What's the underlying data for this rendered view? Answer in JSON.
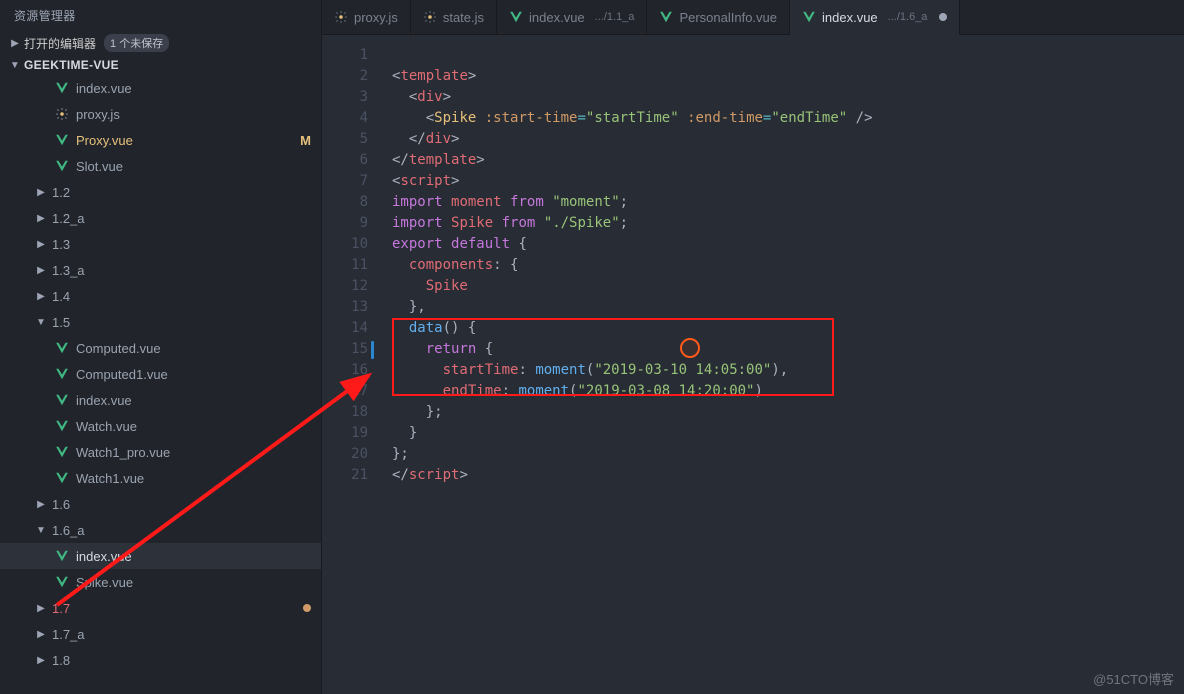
{
  "sidebar": {
    "title": "资源管理器",
    "open_editors_label": "打开的编辑器",
    "open_editors_badge": "1 个未保存",
    "project_name": "GEEKTIME-VUE",
    "items": [
      {
        "type": "file",
        "icon": "vue",
        "label": "index.vue",
        "indent": 3
      },
      {
        "type": "file",
        "icon": "js",
        "label": "proxy.js",
        "indent": 3
      },
      {
        "type": "file",
        "icon": "vue",
        "label": "Proxy.vue",
        "indent": 3,
        "modified": true,
        "status": "M"
      },
      {
        "type": "file",
        "icon": "vue",
        "label": "Slot.vue",
        "indent": 3
      },
      {
        "type": "folder",
        "label": "1.2",
        "indent": 2,
        "expanded": false
      },
      {
        "type": "folder",
        "label": "1.2_a",
        "indent": 2,
        "expanded": false
      },
      {
        "type": "folder",
        "label": "1.3",
        "indent": 2,
        "expanded": false
      },
      {
        "type": "folder",
        "label": "1.3_a",
        "indent": 2,
        "expanded": false
      },
      {
        "type": "folder",
        "label": "1.4",
        "indent": 2,
        "expanded": false
      },
      {
        "type": "folder",
        "label": "1.5",
        "indent": 2,
        "expanded": true
      },
      {
        "type": "file",
        "icon": "vue",
        "label": "Computed.vue",
        "indent": 3
      },
      {
        "type": "file",
        "icon": "vue",
        "label": "Computed1.vue",
        "indent": 3
      },
      {
        "type": "file",
        "icon": "vue",
        "label": "index.vue",
        "indent": 3
      },
      {
        "type": "file",
        "icon": "vue",
        "label": "Watch.vue",
        "indent": 3
      },
      {
        "type": "file",
        "icon": "vue",
        "label": "Watch1_pro.vue",
        "indent": 3
      },
      {
        "type": "file",
        "icon": "vue",
        "label": "Watch1.vue",
        "indent": 3
      },
      {
        "type": "folder",
        "label": "1.6",
        "indent": 2,
        "expanded": false
      },
      {
        "type": "folder",
        "label": "1.6_a",
        "indent": 2,
        "expanded": true
      },
      {
        "type": "file",
        "icon": "vue",
        "label": "index.vue",
        "indent": 3,
        "selected": true
      },
      {
        "type": "file",
        "icon": "vue",
        "label": "Spike.vue",
        "indent": 3
      },
      {
        "type": "folder",
        "label": "1.7",
        "indent": 2,
        "expanded": false,
        "git": true,
        "dot": true
      },
      {
        "type": "folder",
        "label": "1.7_a",
        "indent": 2,
        "expanded": false
      },
      {
        "type": "folder",
        "label": "1.8",
        "indent": 2,
        "expanded": false
      }
    ]
  },
  "tabs": [
    {
      "icon": "js",
      "label": "proxy.js"
    },
    {
      "icon": "js",
      "label": "state.js"
    },
    {
      "icon": "vue",
      "label": "index.vue",
      "path": ".../1.1_a"
    },
    {
      "icon": "vue",
      "label": "PersonalInfo.vue"
    },
    {
      "icon": "vue",
      "label": "index.vue",
      "path": ".../1.6_a",
      "active": true,
      "dirty": true
    }
  ],
  "code": {
    "l1": {
      "open": "<",
      "tag": "template",
      "close": ">"
    },
    "l2": {
      "open": "<",
      "tag": "div",
      "close": ">"
    },
    "l3": {
      "open": "<",
      "comp": "Spike",
      "a1": ":start-time",
      "eq": "=",
      "v1": "\"startTime\"",
      "a2": ":end-time",
      "v2": "\"endTime\"",
      "end": " />"
    },
    "l4": {
      "open": "</",
      "tag": "div",
      "close": ">"
    },
    "l5": {
      "open": "</",
      "tag": "template",
      "close": ">"
    },
    "l6": {
      "open": "<",
      "tag": "script",
      "close": ">"
    },
    "l7": {
      "kw1": "import",
      "var": "moment",
      "kw2": "from",
      "str": "\"moment\"",
      "sc": ";"
    },
    "l8": {
      "kw1": "import",
      "var": "Spike",
      "kw2": "from",
      "str": "\"./Spike\"",
      "sc": ";"
    },
    "l9": {
      "kw1": "export",
      "kw2": "default",
      "brace": "{"
    },
    "l10": {
      "key": "components",
      "colon": ":",
      "brace": " {"
    },
    "l11": {
      "var": "Spike"
    },
    "l12": {
      "brace": "},"
    },
    "l13": {
      "fn": "data",
      "parens": "()",
      "brace": " {"
    },
    "l14": {
      "kw": "return",
      "brace": " {"
    },
    "l15": {
      "key": "startTime",
      "colon": ":",
      "fn": "moment",
      "open": "(",
      "str": "\"2019-03-10 14:05:00\"",
      "close": "),"
    },
    "l16": {
      "key": "endTime",
      "colon": ":",
      "fn": "moment",
      "open": "(",
      "str": "\"2019-03-08 14:20:00\"",
      "close": ")"
    },
    "l17": {
      "brace": "};"
    },
    "l18": {
      "brace": "}"
    },
    "l19": {
      "brace": "};"
    },
    "l20": {
      "open": "</",
      "tag": "script",
      "close": ">"
    },
    "lines": [
      "1",
      "2",
      "3",
      "4",
      "5",
      "6",
      "7",
      "8",
      "9",
      "10",
      "11",
      "12",
      "13",
      "14",
      "15",
      "16",
      "17",
      "18",
      "19",
      "20",
      "21"
    ]
  },
  "watermark": "@51CTO博客"
}
